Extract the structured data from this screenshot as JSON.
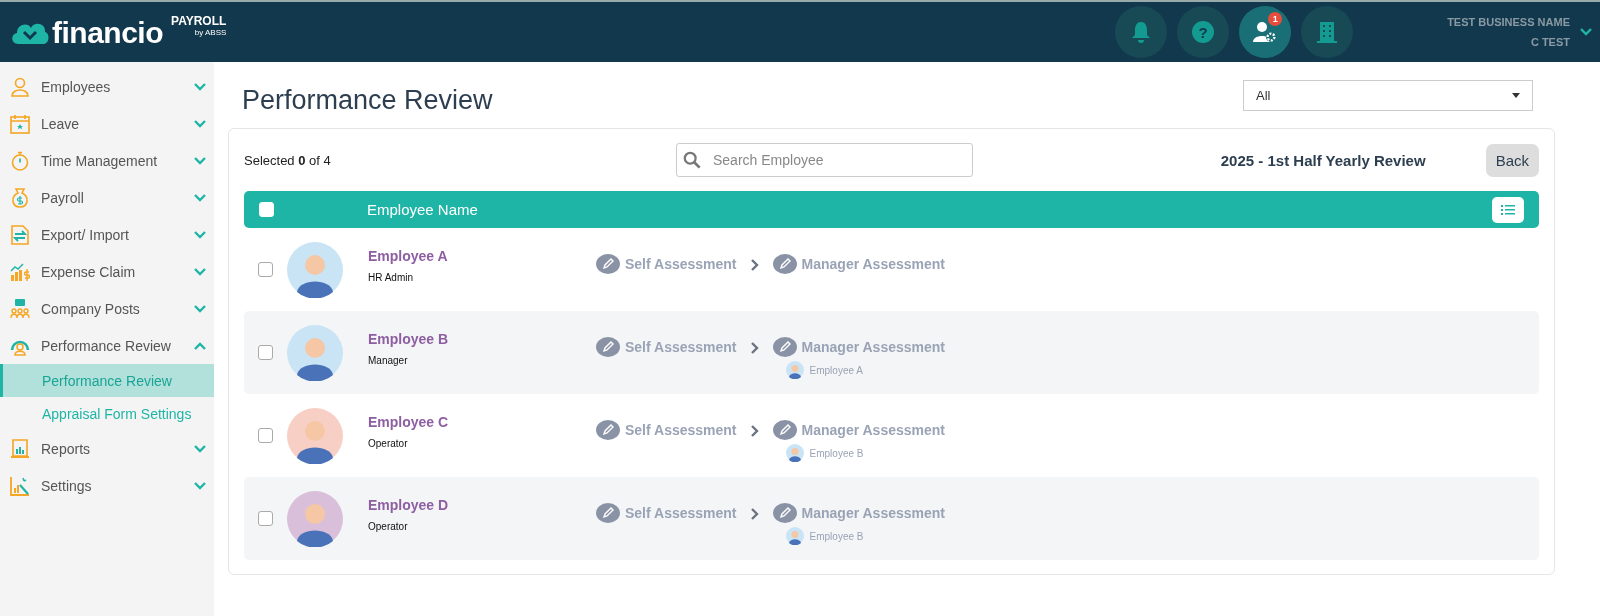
{
  "header": {
    "logo": "financio",
    "product": "PAYROLL",
    "product_by": "by ABSS",
    "actions": [
      {
        "kind": "bell",
        "selected": false
      },
      {
        "kind": "help",
        "selected": false,
        "label": "?"
      },
      {
        "kind": "user-settings",
        "selected": true,
        "badge": "1"
      },
      {
        "kind": "building",
        "selected": false
      }
    ],
    "business_name": "TEST BUSINESS NAME",
    "user_name": "C TEST"
  },
  "sidebar": {
    "items": [
      {
        "label": "Employees",
        "kind": "person",
        "expanded": false
      },
      {
        "label": "Leave",
        "kind": "calendar",
        "expanded": false
      },
      {
        "label": "Time Management",
        "kind": "stopwatch",
        "expanded": false
      },
      {
        "label": "Payroll",
        "kind": "moneybag",
        "expanded": false
      },
      {
        "label": "Export/ Import",
        "kind": "export",
        "expanded": false
      },
      {
        "label": "Expense Claim",
        "kind": "chart",
        "expanded": false
      },
      {
        "label": "Company Posts",
        "kind": "people",
        "expanded": false
      },
      {
        "label": "Performance Review",
        "kind": "gauge",
        "expanded": true,
        "children": [
          {
            "label": "Performance Review",
            "selected": true
          },
          {
            "label": "Appraisal Form Settings",
            "selected": false
          }
        ]
      },
      {
        "label": "Reports",
        "kind": "report",
        "expanded": false
      },
      {
        "label": "Settings",
        "kind": "settings",
        "expanded": false
      }
    ]
  },
  "page": {
    "title": "Performance Review",
    "filter": {
      "value": "All"
    },
    "selected_text": "Selected **0** of 4",
    "search": {
      "placeholder": "Search Employee"
    },
    "review_title": "2025 - 1st Half Yearly Review",
    "back_button": "Back",
    "table": {
      "select_all": {
        "checked": false
      },
      "column": "Employee Name",
      "rows": [
        {
          "checked": false,
          "name": "Employee A",
          "role": "HR Admin",
          "color": "#c9e4f5",
          "steps": [
            "Self Assessment",
            "Manager Assessment"
          ]
        },
        {
          "checked": false,
          "name": "Employee B",
          "role": "Manager",
          "color": "#c9e4f5",
          "steps": [
            "Self Assessment",
            "Manager Assessment"
          ],
          "manager": {
            "name": "Employee A",
            "color": "#c9e4f5"
          }
        },
        {
          "checked": false,
          "name": "Employee C",
          "role": "Operator",
          "color": "#f8cfc4",
          "steps": [
            "Self Assessment",
            "Manager Assessment"
          ],
          "manager": {
            "name": "Employee B",
            "color": "#c9e4f5"
          }
        },
        {
          "checked": false,
          "name": "Employee D",
          "role": "Operator",
          "color": "#d9bfd9",
          "steps": [
            "Self Assessment",
            "Manager Assessment"
          ],
          "manager": {
            "name": "Employee B",
            "color": "#c9e4f5"
          }
        }
      ]
    }
  }
}
